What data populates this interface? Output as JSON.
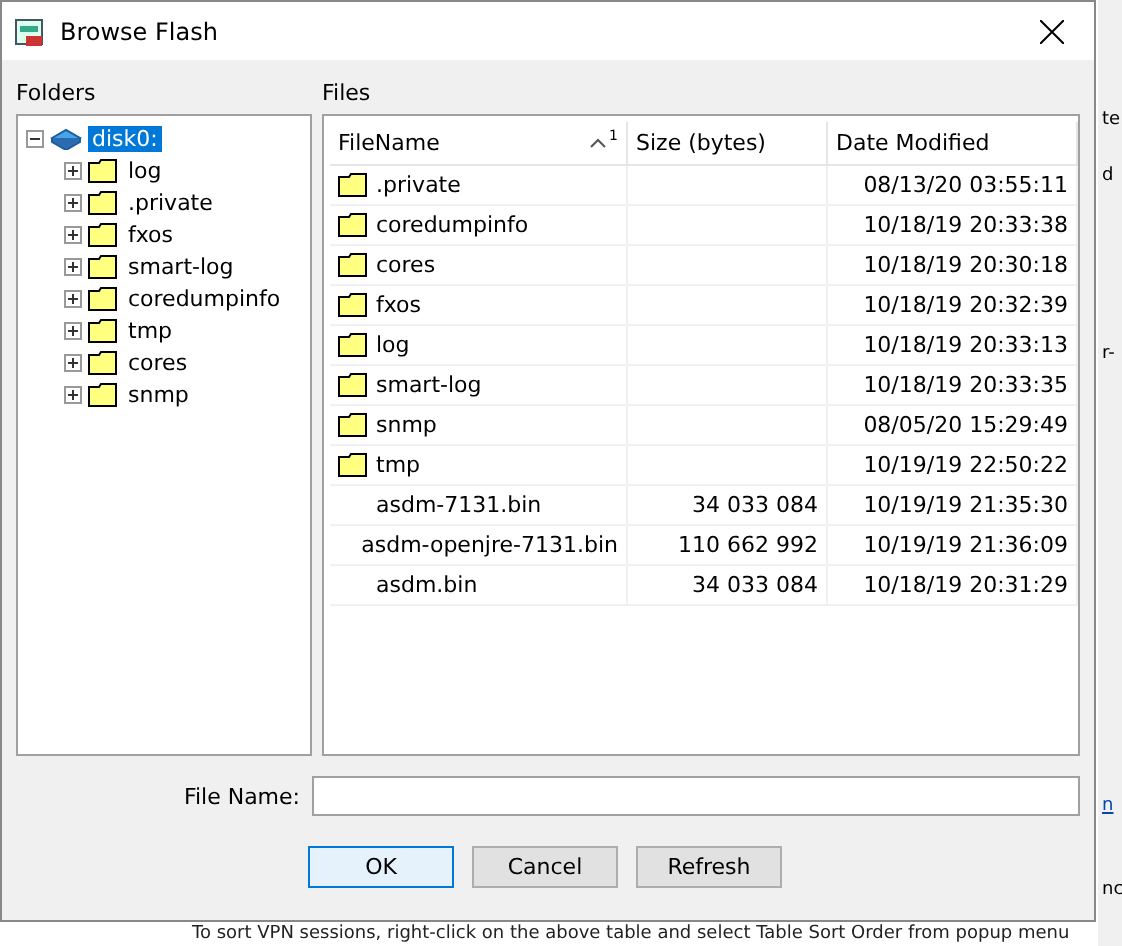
{
  "window": {
    "title": "Browse Flash"
  },
  "folders": {
    "label": "Folders",
    "root": {
      "label": "disk0:",
      "selected": true,
      "expanded": true,
      "children": [
        {
          "label": "log",
          "expanded": false
        },
        {
          "label": ".private",
          "expanded": false
        },
        {
          "label": "fxos",
          "expanded": false
        },
        {
          "label": "smart-log",
          "expanded": false
        },
        {
          "label": "coredumpinfo",
          "expanded": false
        },
        {
          "label": "tmp",
          "expanded": false
        },
        {
          "label": "cores",
          "expanded": false
        },
        {
          "label": "snmp",
          "expanded": false
        }
      ]
    }
  },
  "files": {
    "label": "Files",
    "columns": [
      {
        "label": "FileName",
        "sorted": true,
        "sort_rank": "1"
      },
      {
        "label": "Size (bytes)",
        "sorted": false
      },
      {
        "label": "Date Modified",
        "sorted": false
      }
    ],
    "rows": [
      {
        "kind": "folder",
        "name": ".private",
        "size": "",
        "modified": "08/13/20 03:55:11"
      },
      {
        "kind": "folder",
        "name": "coredumpinfo",
        "size": "",
        "modified": "10/18/19 20:33:38"
      },
      {
        "kind": "folder",
        "name": "cores",
        "size": "",
        "modified": "10/18/19 20:30:18"
      },
      {
        "kind": "folder",
        "name": "fxos",
        "size": "",
        "modified": "10/18/19 20:32:39"
      },
      {
        "kind": "folder",
        "name": "log",
        "size": "",
        "modified": "10/18/19 20:33:13"
      },
      {
        "kind": "folder",
        "name": "smart-log",
        "size": "",
        "modified": "10/18/19 20:33:35"
      },
      {
        "kind": "folder",
        "name": "snmp",
        "size": "",
        "modified": "08/05/20 15:29:49"
      },
      {
        "kind": "folder",
        "name": "tmp",
        "size": "",
        "modified": "10/19/19 22:50:22"
      },
      {
        "kind": "file",
        "name": "asdm-7131.bin",
        "size": "34 033 084",
        "modified": "10/19/19 21:35:30"
      },
      {
        "kind": "file",
        "name": "asdm-openjre-7131.bin",
        "size": "110 662 992",
        "modified": "10/19/19 21:36:09"
      },
      {
        "kind": "file",
        "name": "asdm.bin",
        "size": "34 033 084",
        "modified": "10/18/19 20:31:29"
      }
    ]
  },
  "file_name": {
    "label": "File Name:"
  },
  "buttons": [
    {
      "label": "OK",
      "default": true
    },
    {
      "label": "Cancel",
      "default": false
    },
    {
      "label": "Refresh",
      "default": false
    }
  ],
  "background": {
    "fragments": [
      {
        "kind": "text",
        "text": "te"
      },
      {
        "kind": "text",
        "text": "d"
      },
      {
        "kind": "text",
        "text": "r-"
      },
      {
        "kind": "link",
        "text": "n"
      },
      {
        "kind": "text",
        "text": "nc"
      }
    ],
    "footer": "To sort VPN sessions, right-click on the above table and select Table Sort Order from popup menu"
  }
}
